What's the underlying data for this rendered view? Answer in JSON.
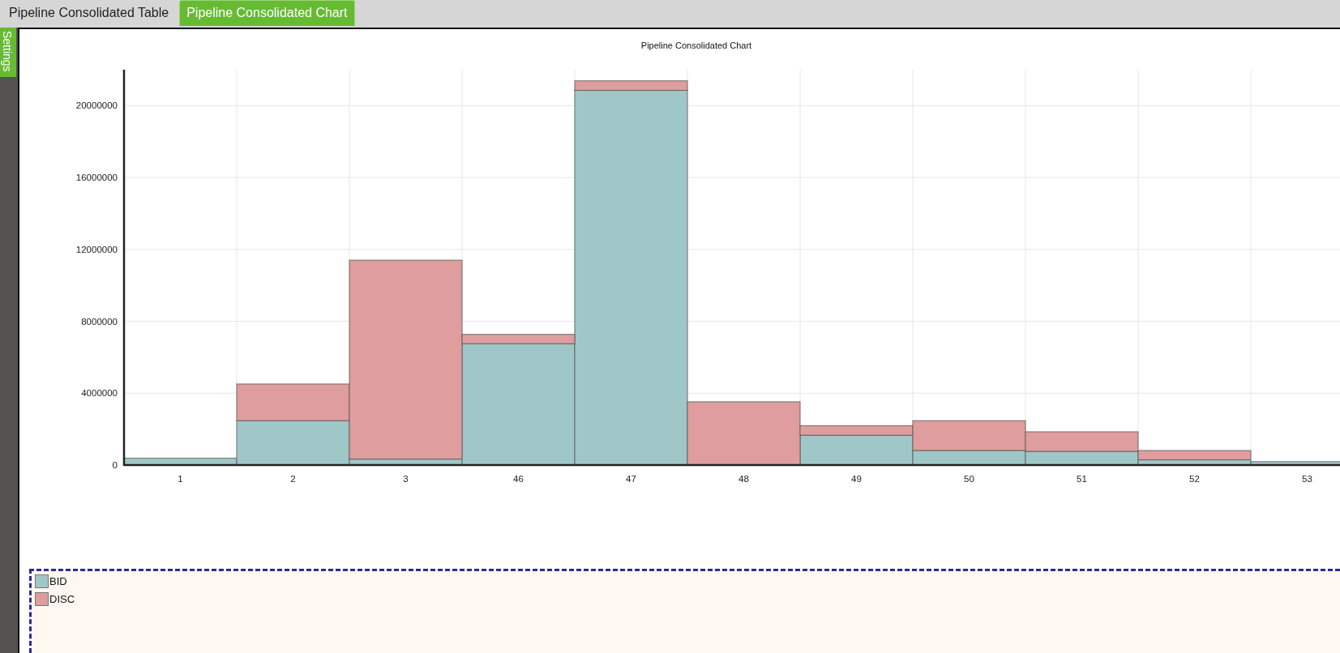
{
  "tabs": [
    {
      "label": "Pipeline Consolidated Table",
      "selected": false
    },
    {
      "label": "Pipeline Consolidated Chart",
      "selected": true
    }
  ],
  "sidebar": {
    "settings_tab": "Settings"
  },
  "chart": {
    "chart_data": {
      "type": "bar",
      "title": "Pipeline Consolidated Chart",
      "stacked": true,
      "grid": true,
      "categories": [
        "1",
        "2",
        "3",
        "46",
        "47",
        "48",
        "49",
        "50",
        "51",
        "52",
        "53"
      ],
      "ylim": [
        0,
        22000000
      ],
      "yticks": [
        0,
        4000000,
        8000000,
        12000000,
        16000000,
        20000000
      ],
      "series": [
        {
          "name": "BID",
          "color": "#a0c7c8",
          "values": [
            380000,
            2470000,
            330000,
            6750000,
            20850000,
            0,
            1660000,
            810000,
            760000,
            290000,
            190000
          ]
        },
        {
          "name": "DISC",
          "color": "#e09d9d",
          "values": [
            0,
            2040000,
            11070000,
            520000,
            530000,
            3520000,
            530000,
            1660000,
            1090000,
            520000,
            0
          ]
        }
      ]
    }
  }
}
